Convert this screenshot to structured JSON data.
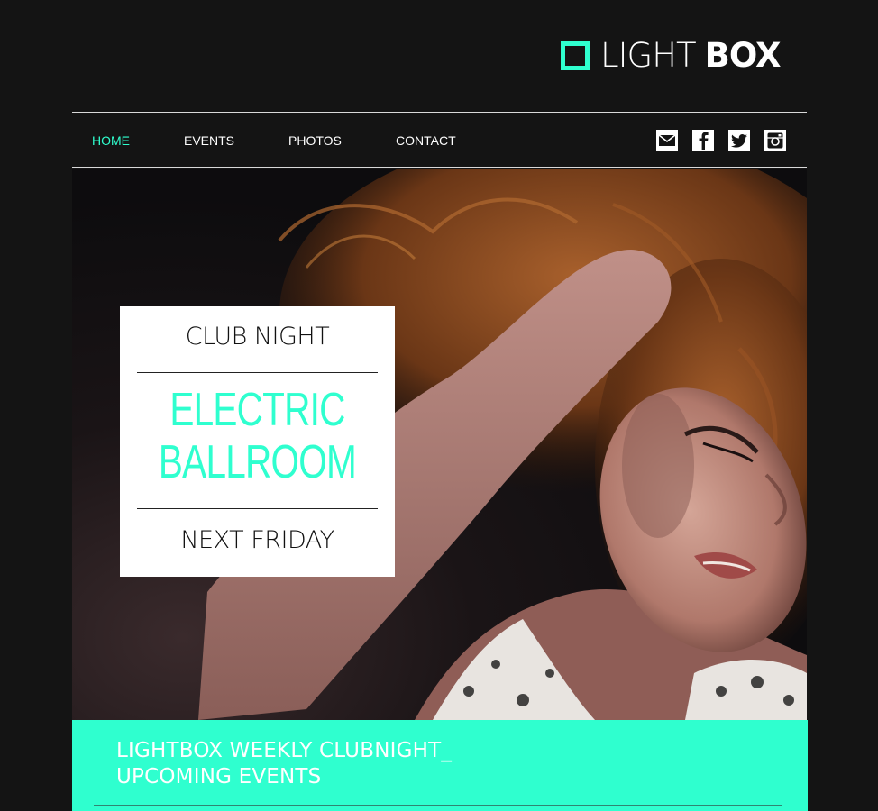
{
  "logo": {
    "light": "LIGHT",
    "box": "BOX"
  },
  "nav": {
    "items": [
      {
        "label": "HOME",
        "active": true
      },
      {
        "label": "EVENTS",
        "active": false
      },
      {
        "label": "PHOTOS",
        "active": false
      },
      {
        "label": "CONTACT",
        "active": false
      }
    ],
    "social": [
      "mail-icon",
      "facebook-icon",
      "twitter-icon",
      "instagram-icon"
    ]
  },
  "promo": {
    "top": "CLUB NIGHT",
    "title_line1": "ELECTRIC",
    "title_line2": "BALLROOM",
    "bottom": "NEXT FRIDAY"
  },
  "band": {
    "line1": "LIGHTBOX WEEKLY CLUBNIGHT_",
    "line2": "UPCOMING EVENTS"
  },
  "colors": {
    "accent": "#2fffcf",
    "background": "#141414",
    "text_light": "#ffffff"
  }
}
